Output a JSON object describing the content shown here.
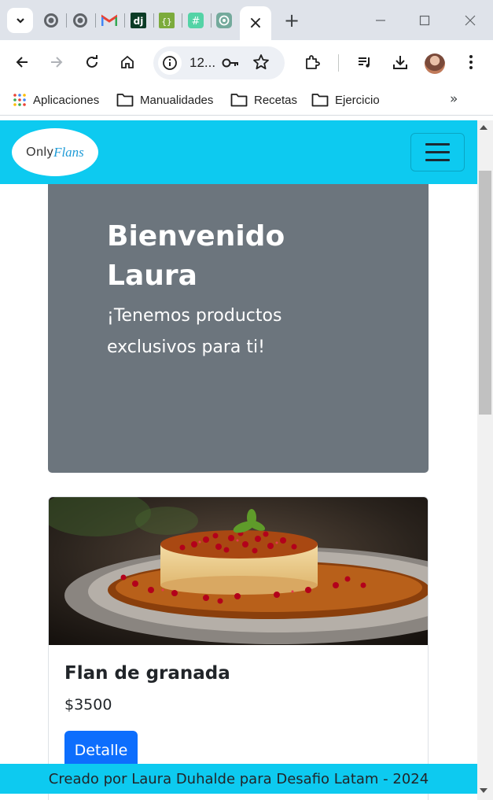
{
  "browser": {
    "url_display": "12...",
    "tabs": {
      "pinned_icons": [
        "github-icon",
        "github-icon",
        "gmail-icon",
        "django-icon",
        "json-icon",
        "hashtag-icon",
        "chatgpt-icon"
      ],
      "active_close": "×",
      "new_tab": "+"
    },
    "bookmarks": {
      "apps_label": "Aplicaciones",
      "folders": [
        "Manualidades",
        "Recetas",
        "Ejercicio"
      ],
      "more": "»"
    }
  },
  "page": {
    "brand": {
      "only": "Only",
      "flans": "Flans"
    },
    "hero": {
      "title": "Bienvenido Laura",
      "subtitle": "¡Tenemos productos exclusivos para ti!"
    },
    "product": {
      "name": "Flan de granada",
      "price": "$3500",
      "button_label": "Detalle"
    },
    "footer_text": "Creado por Laura Duhalde para Desafio Latam - 2024"
  },
  "colors": {
    "navbar_bg": "#0dcaf0",
    "hero_bg": "#6c757d",
    "button_primary": "#0d6efd",
    "tabbar_bg": "#dfe3ea"
  }
}
